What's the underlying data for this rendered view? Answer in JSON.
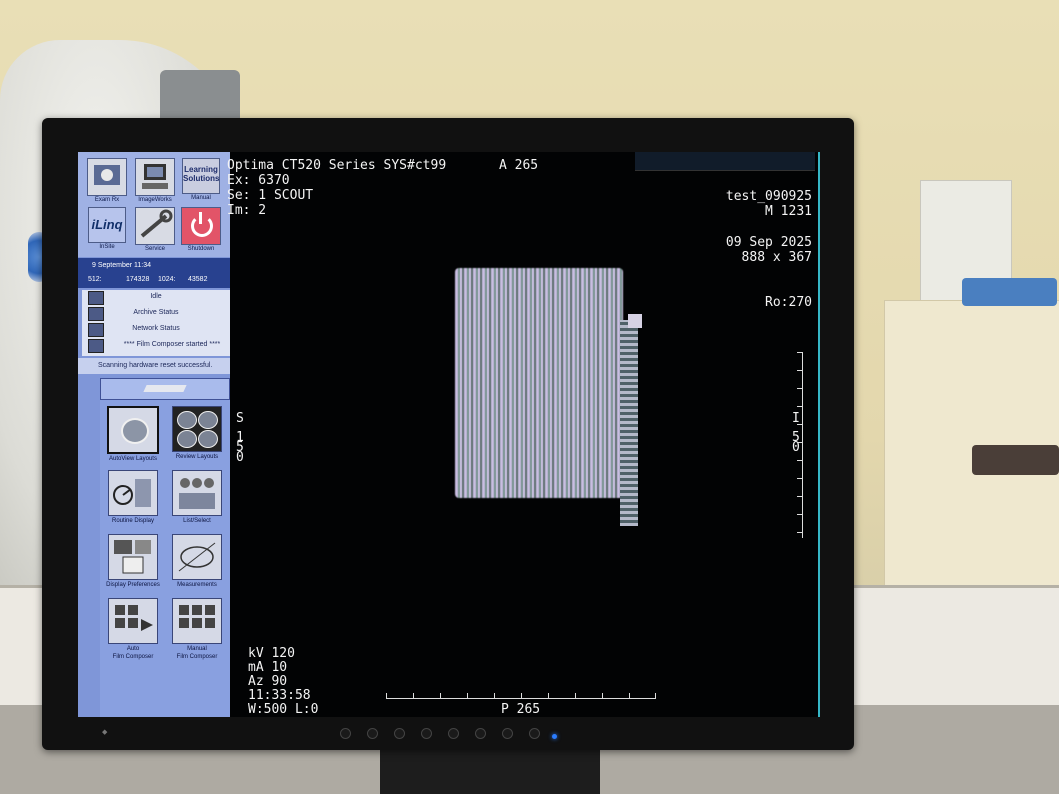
{
  "left_panel": {
    "top_icons": [
      {
        "label": "Exam Rx",
        "icon": "exam-rx-icon"
      },
      {
        "label": "ImageWorks",
        "icon": "imageworks-icon"
      },
      {
        "label": "Manual",
        "icon": "manual-icon",
        "box_text_line1": "Learning",
        "box_text_line2": "Solutions"
      },
      {
        "label": "InSite",
        "icon": "insite-icon",
        "box_text": "iLinq"
      },
      {
        "label": "Service",
        "icon": "service-icon"
      },
      {
        "label": "Shutdown",
        "icon": "power-icon"
      }
    ],
    "date": "9 September 11:34",
    "matrix": {
      "k512": "512:",
      "v512": "174328",
      "k1024": "1024:",
      "v1024": "43582"
    },
    "status": {
      "idle": "Idle",
      "archive": "Archive Status",
      "network": "Network Status",
      "film": "**** Film Composer started ****"
    },
    "message": "Scanning hardware reset successful.",
    "tools": [
      {
        "label": "AutoView Layouts",
        "icon": "autoview-layouts-icon",
        "selected": true
      },
      {
        "label": "Review Layouts",
        "icon": "review-layouts-icon"
      },
      {
        "label": "Routine Display",
        "icon": "routine-display-icon"
      },
      {
        "label": "List/Select",
        "icon": "list-select-icon"
      },
      {
        "label": "Display Preferences",
        "icon": "display-preferences-icon"
      },
      {
        "label": "Measurements",
        "icon": "measurements-icon"
      },
      {
        "label_line1": "Auto",
        "label_line2": "Film Composer",
        "icon": "auto-film-composer-icon"
      },
      {
        "label_line1": "Manual",
        "label_line2": "Film Composer",
        "icon": "manual-film-composer-icon"
      }
    ]
  },
  "viewer": {
    "header_line": "Optima CT520 Series  SYS#ct99",
    "anterior": "A 265",
    "exam": "Ex: 6370",
    "series": "Se: 1 SCOUT",
    "image": "Im: 2",
    "patient": "test_090925",
    "sex_id": "M 1231",
    "date": "09 Sep 2025",
    "size": "888 x 367",
    "rotation": "Ro:270",
    "left_orient": [
      "S",
      "1",
      "5",
      "0"
    ],
    "right_orient": [
      "I",
      "5",
      "0"
    ],
    "kv": "kV 120",
    "ma": "mA 10",
    "az": "Az 90",
    "time": "11:33:58",
    "window": "W:500 L:0",
    "posterior": "P 265"
  },
  "colors": {
    "panel": "#7f96d8",
    "accent": "#28418f",
    "viewport_border": "#36b7c7"
  }
}
